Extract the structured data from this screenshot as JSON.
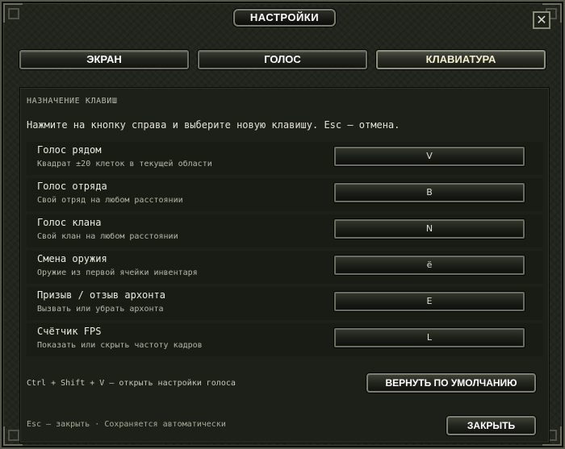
{
  "window": {
    "title": "НАСТРОЙКИ",
    "close_symbol": "✕"
  },
  "tabs": [
    {
      "label": "ЭКРАН",
      "active": false
    },
    {
      "label": "ГОЛОС",
      "active": false
    },
    {
      "label": "КЛАВИАТУРА",
      "active": true
    }
  ],
  "section": {
    "title": "НАЗНАЧЕНИЕ КЛАВИШ",
    "hint": "Нажмите на кнопку справа и выберите новую клавишу. Esc — отмена."
  },
  "bindings": [
    {
      "title": "Голос рядом",
      "description": "Квадрат ±20 клеток в текущей области",
      "key": "V"
    },
    {
      "title": "Голос отряда",
      "description": "Свой отряд на любом расстоянии",
      "key": "B"
    },
    {
      "title": "Голос клана",
      "description": "Свой клан на любом расстоянии",
      "key": "N"
    },
    {
      "title": "Смена оружия",
      "description": "Оружие из первой ячейки инвентаря",
      "key": "ё"
    },
    {
      "title": "Призыв / отзыв архонта",
      "description": "Вызвать или убрать архонта",
      "key": "E"
    },
    {
      "title": "Счётчик FPS",
      "description": "Показать или скрыть частоту кадров",
      "key": "L"
    }
  ],
  "footer": {
    "voice_shortcut_note": "Ctrl + Shift + V — открыть настройки голоса",
    "reset_label": "ВЕРНУТЬ ПО УМОЛЧАНИЮ",
    "status_text": "Esc — закрыть · Сохраняется автоматически",
    "close_label": "ЗАКРЫТЬ"
  }
}
